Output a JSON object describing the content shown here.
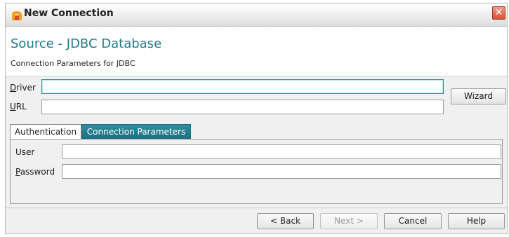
{
  "window": {
    "title": "New Connection",
    "close_symbol": "✕"
  },
  "header": {
    "title": "Source - JDBC Database",
    "subtitle": "Connection Parameters for JDBC"
  },
  "form": {
    "driver": {
      "label_key": "D",
      "label_rest": "river",
      "value": ""
    },
    "url": {
      "label_key": "U",
      "label_rest": "RL",
      "value": ""
    },
    "wizard_label": "Wizard"
  },
  "tabs": [
    {
      "label": "Authentication",
      "active": true
    },
    {
      "label": "Connection Parameters",
      "active": false
    }
  ],
  "auth": {
    "user": {
      "label": "User",
      "value": ""
    },
    "password": {
      "label_key": "P",
      "label_rest": "assword",
      "value": ""
    }
  },
  "footer": {
    "back_label": "< Back",
    "next_label": "Next >",
    "cancel_label": "Cancel",
    "help_label": "Help"
  },
  "colors": {
    "accent": "#1f7a8a",
    "tab_inactive": "#2a8d9a"
  }
}
